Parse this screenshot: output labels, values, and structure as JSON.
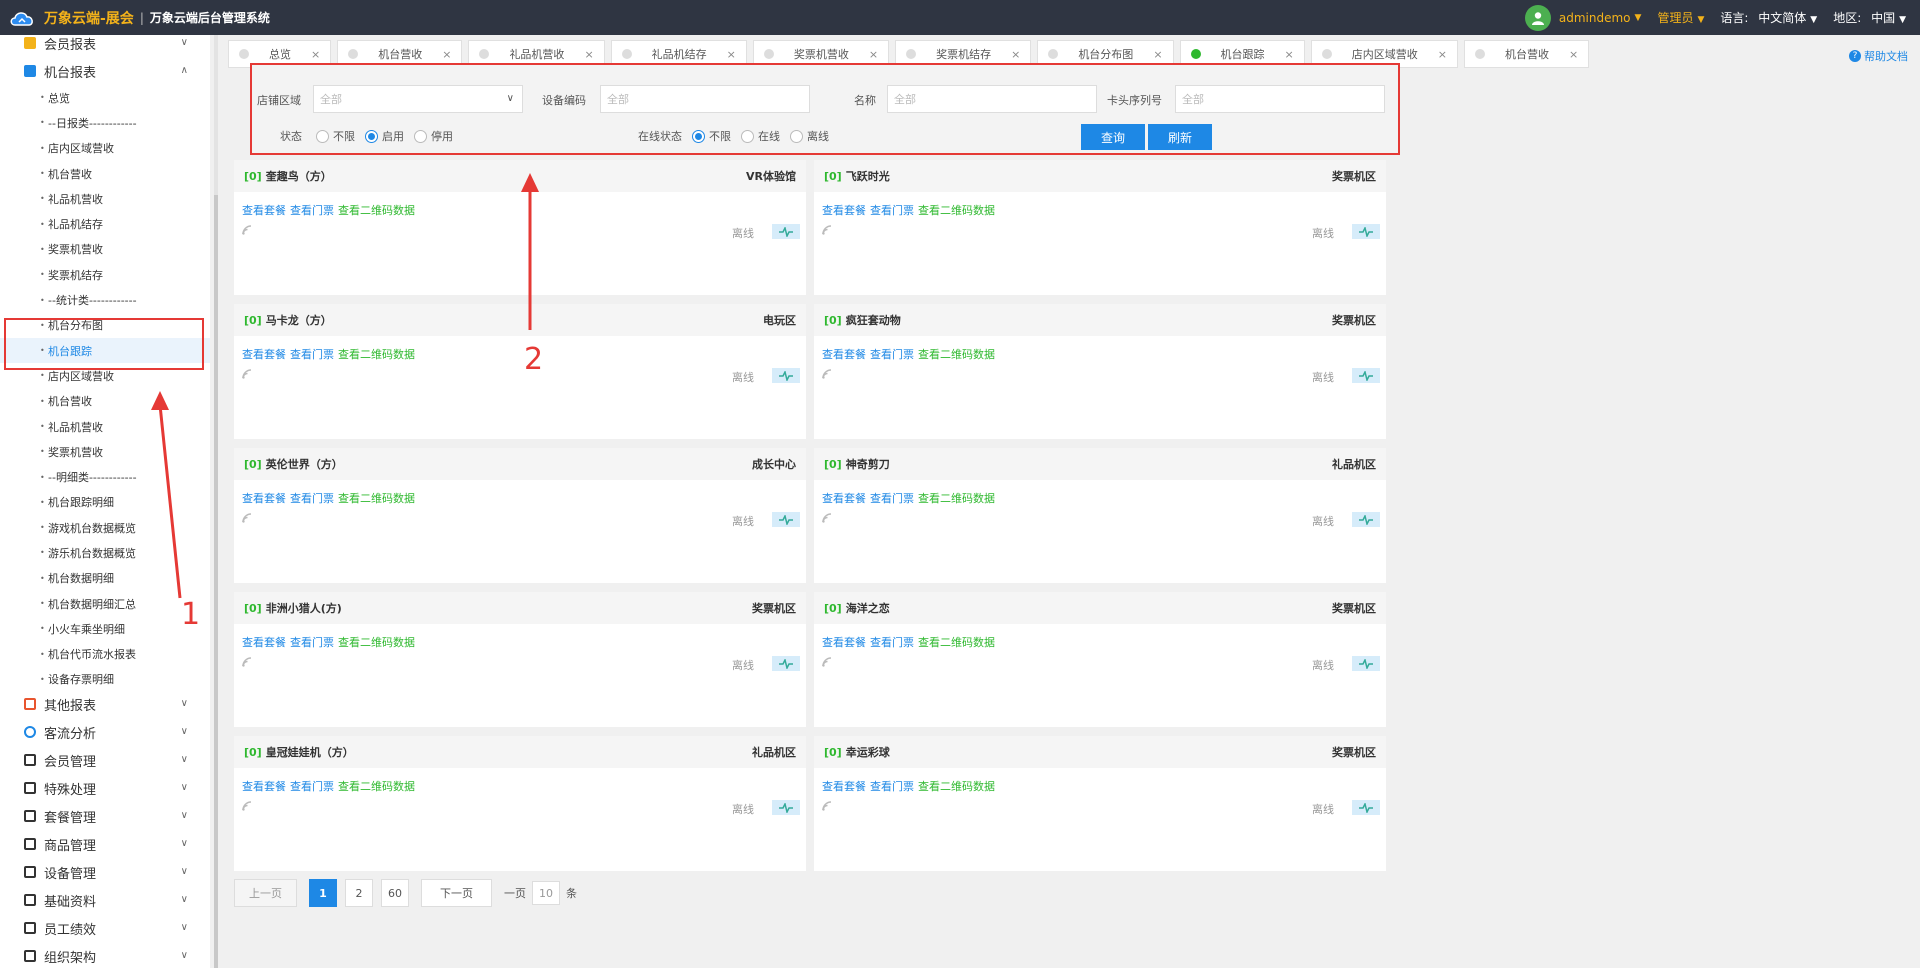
{
  "header": {
    "brand": "万象云端-展会",
    "separator": "|",
    "system_name": "万象云端后台管理系统",
    "username": "admindemo",
    "role": "管理员",
    "language_label": "语言:",
    "language_value": "中文简体",
    "region_label": "地区:",
    "region_value": "中国"
  },
  "sidebar": {
    "top_menu": [
      {
        "label": "会员报表",
        "icon": "member-report-icon"
      },
      {
        "label": "机台报表",
        "icon": "machine-report-icon"
      }
    ],
    "sub_items": [
      "总览",
      "--日报类------------",
      "店内区域营收",
      "机台营收",
      "礼品机营收",
      "礼品机结存",
      "奖票机营收",
      "奖票机结存",
      "--统计类------------",
      "机台分布图",
      "机台跟踪",
      "店内区域营收",
      "机台营收",
      "礼品机营收",
      "奖票机营收",
      "--明细类------------",
      "机台跟踪明细",
      "游戏机台数据概览",
      "游乐机台数据概览",
      "机台数据明细",
      "机台数据明细汇总",
      "小火车乘坐明细",
      "机台代币流水报表",
      "设备存票明细"
    ],
    "active_index": 10,
    "groups": [
      {
        "label": "其他报表",
        "icon": "layers-icon"
      },
      {
        "label": "客流分析",
        "icon": "flow-icon"
      },
      {
        "label": "会员管理",
        "icon": "user-icon"
      },
      {
        "label": "特殊处理",
        "icon": "warning-icon"
      },
      {
        "label": "套餐管理",
        "icon": "package-icon"
      },
      {
        "label": "商品管理",
        "icon": "exchange-icon"
      },
      {
        "label": "设备管理",
        "icon": "device-icon"
      },
      {
        "label": "基础资料",
        "icon": "file-icon"
      },
      {
        "label": "员工绩效",
        "icon": "performance-icon"
      },
      {
        "label": "组织架构",
        "icon": "org-icon"
      }
    ]
  },
  "tabs": [
    {
      "label": "总览",
      "active": false
    },
    {
      "label": "机台营收",
      "active": false
    },
    {
      "label": "礼品机营收",
      "active": false
    },
    {
      "label": "礼品机结存",
      "active": false
    },
    {
      "label": "奖票机营收",
      "active": false
    },
    {
      "label": "奖票机结存",
      "active": false
    },
    {
      "label": "机台分布图",
      "active": false
    },
    {
      "label": "机台跟踪",
      "active": true
    },
    {
      "label": "店内区域营收",
      "active": false
    },
    {
      "label": "机台营收",
      "active": false
    }
  ],
  "help_label": "帮助文档",
  "filter": {
    "store_area_label": "店铺区域",
    "store_area_value": "全部",
    "device_code_label": "设备编码",
    "device_code_placeholder": "全部",
    "name_label": "名称",
    "name_placeholder": "全部",
    "card_serial_label": "卡头序列号",
    "card_serial_placeholder": "全部",
    "status_label": "状态",
    "status_options": [
      "不限",
      "启用",
      "停用"
    ],
    "status_selected": 1,
    "online_label": "在线状态",
    "online_options": [
      "不限",
      "在线",
      "离线"
    ],
    "online_selected": 0,
    "query_label": "查询",
    "refresh_label": "刷新"
  },
  "card_links": [
    "查看套餐",
    "查看门票",
    "查看二维码数据"
  ],
  "cards": [
    {
      "idx": "[0]",
      "name": "奎趣鸟（方）",
      "zone": "VR体验馆",
      "status": "离线"
    },
    {
      "idx": "[0]",
      "name": "飞跃时光",
      "zone": "奖票机区",
      "status": "离线"
    },
    {
      "idx": "[0]",
      "name": "马卡龙（方）",
      "zone": "电玩区",
      "status": "离线"
    },
    {
      "idx": "[0]",
      "name": "疯狂套动物",
      "zone": "奖票机区",
      "status": "离线"
    },
    {
      "idx": "[0]",
      "name": "英伦世界（方）",
      "zone": "成长中心",
      "status": "离线"
    },
    {
      "idx": "[0]",
      "name": "神奇剪刀",
      "zone": "礼品机区",
      "status": "离线"
    },
    {
      "idx": "[0]",
      "name": "非洲小猎人(方)",
      "zone": "奖票机区",
      "status": "离线"
    },
    {
      "idx": "[0]",
      "name": "海洋之恋",
      "zone": "奖票机区",
      "status": "离线"
    },
    {
      "idx": "[0]",
      "name": "皇冠娃娃机（方）",
      "zone": "礼品机区",
      "status": "离线"
    },
    {
      "idx": "[0]",
      "name": "幸运彩球",
      "zone": "奖票机区",
      "status": "离线"
    }
  ],
  "pager": {
    "prev": "上一页",
    "pages": [
      "1",
      "2",
      "60"
    ],
    "current": "1",
    "next": "下一页",
    "per_page_prefix": "一页",
    "per_page_value": "10",
    "per_page_suffix": "条"
  },
  "annotations": {
    "one": "1",
    "two": "2"
  },
  "colors": {
    "accent": "#1e88e5",
    "brand": "#f3b21a",
    "topbar": "#2f3542",
    "annotation": "#e53935",
    "online_green": "#2eb82e"
  }
}
